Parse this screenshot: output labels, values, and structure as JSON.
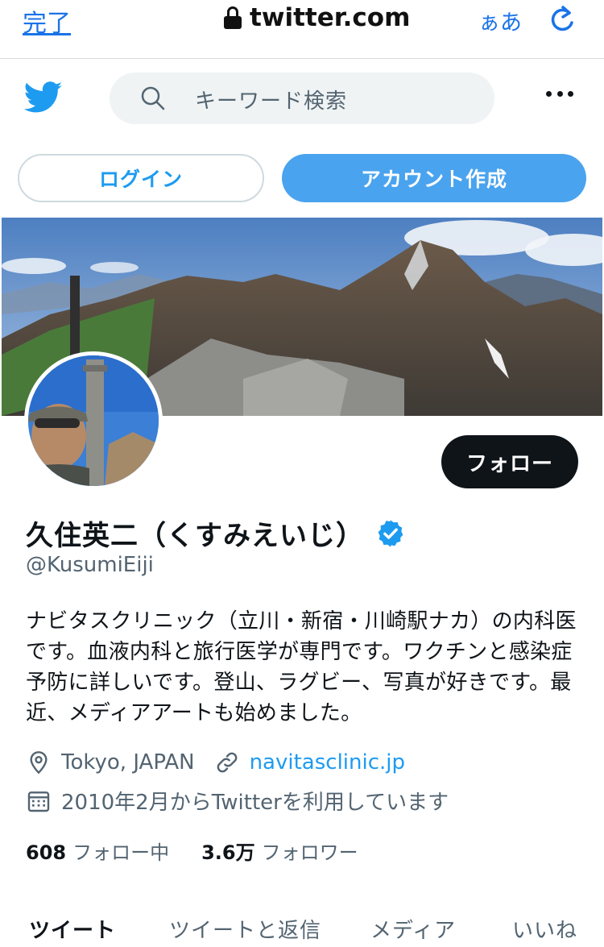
{
  "browser": {
    "done_label": "完了",
    "url": "twitter.com",
    "text_size_label": "ぁあ",
    "reload_icon": "reload-icon",
    "lock_icon": "lock-icon"
  },
  "header": {
    "logo_icon": "twitter-bird-icon",
    "search_placeholder": "キーワード検索",
    "more_icon": "more-dots-icon"
  },
  "auth": {
    "login_label": "ログイン",
    "signup_label": "アカウント作成"
  },
  "profile": {
    "follow_label": "フォロー",
    "name": "久住英二（くすみえいじ）",
    "verified": true,
    "handle": "@KusumiEiji",
    "bio": "ナビタスクリニック（立川・新宿・川崎駅ナカ）の内科医です。血液内科と旅行医学が専門です。ワクチンと感染症予防に詳しいです。登山、ラグビー、写真が好きです。最近、メディアアートも始めました。",
    "location": "Tokyo, JAPAN",
    "website": "navitasclinic.jp",
    "joined": "2010年2月からTwitterを利用しています",
    "following_count": "608",
    "following_label": "フォロー中",
    "followers_count": "3.6万",
    "followers_label": "フォロワー"
  },
  "tabs": [
    {
      "label": "ツイート",
      "active": true
    },
    {
      "label": "ツイートと返信",
      "active": false
    },
    {
      "label": "メディア",
      "active": false
    },
    {
      "label": "いいね",
      "active": false
    }
  ],
  "colors": {
    "accent": "#1d9bf0",
    "signup_bg": "#4aa3ee",
    "follow_bg": "#0f1419",
    "safari_blue": "#1a73e8"
  }
}
